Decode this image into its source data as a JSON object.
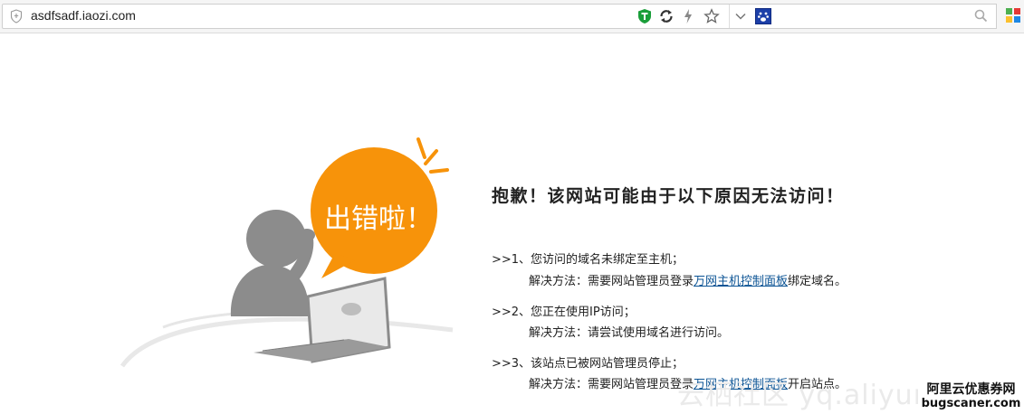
{
  "browser": {
    "url": "asdfsadf.iaozi.com",
    "search_placeholder": ""
  },
  "illustration": {
    "bubble_text": "出错啦！"
  },
  "error": {
    "title": "抱歉！该网站可能由于以下原因无法访问！",
    "reasons": [
      {
        "text": ">>1、您访问的域名未绑定至主机；",
        "solution_prefix": "解决方法：需要网站管理员登录",
        "solution_link": "万网主机控制面板",
        "solution_suffix": "绑定域名。"
      },
      {
        "text": ">>2、您正在使用IP访问；",
        "solution_prefix": "解决方法：请尝试使用域名进行访问。",
        "solution_link": "",
        "solution_suffix": ""
      },
      {
        "text": ">>3、该站点已被网站管理员停止；",
        "solution_prefix": "解决方法：需要网站管理员登录",
        "solution_link": "万网主机控制面板",
        "solution_suffix": "开启站点。"
      }
    ]
  },
  "watermark": {
    "background_text": "云栖社区 yq.aliyun",
    "label_line1": "阿里云优惠券网",
    "label_line2": "bugscaner.com"
  },
  "colors": {
    "bubble_orange": "#f7930a",
    "figure_gray": "#8c8c8c",
    "link_blue": "#0b5394",
    "shield_green": "#1a9e3a"
  },
  "icons": [
    "page-shield-icon",
    "security-shield-icon",
    "refresh-icon",
    "lightning-icon",
    "star-icon",
    "dropdown-icon",
    "search-engine-icon",
    "search-icon",
    "extension-icon"
  ]
}
